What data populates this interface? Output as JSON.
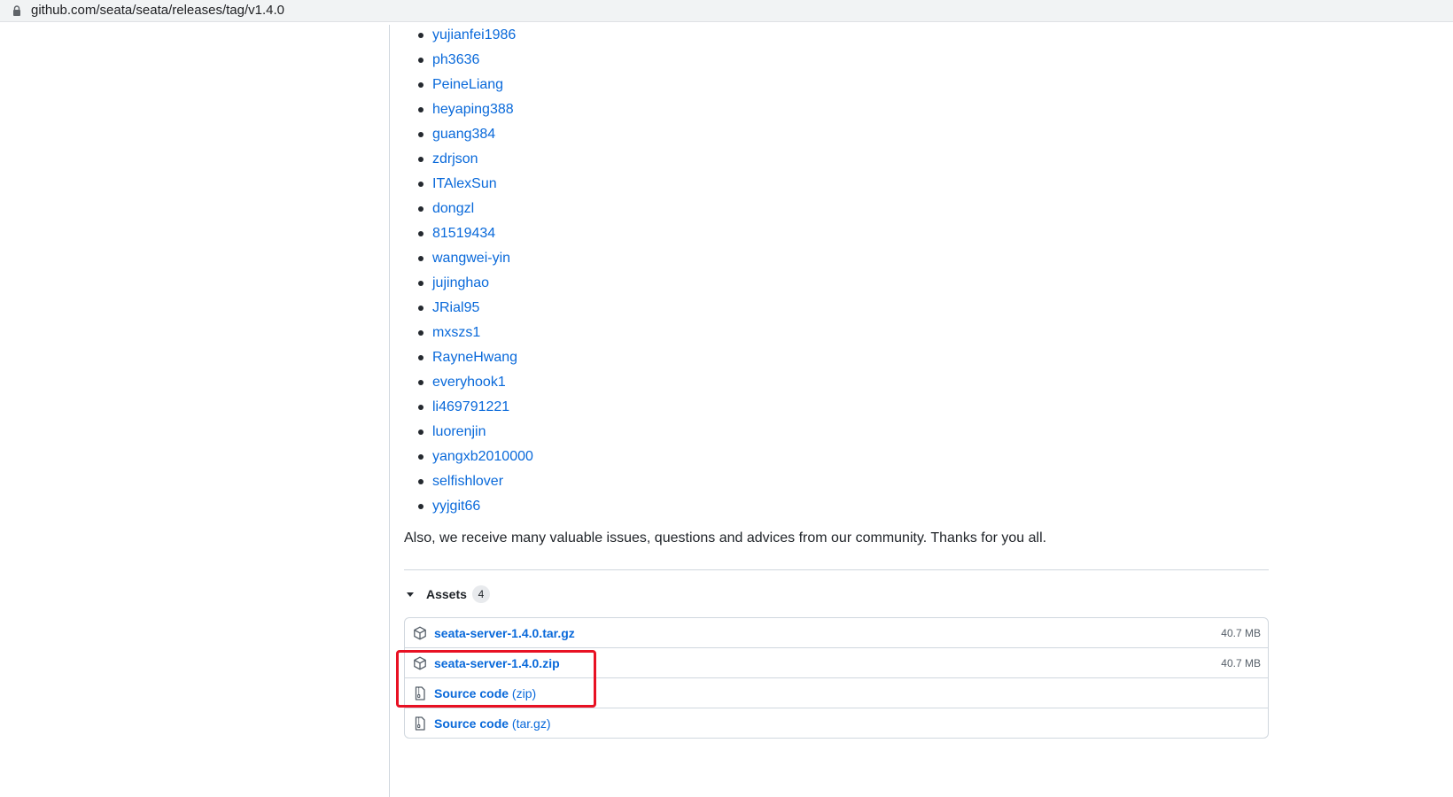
{
  "browser": {
    "url": "github.com/seata/seata/releases/tag/v1.4.0"
  },
  "contributors": [
    "yujianfei1986",
    "ph3636",
    "PeineLiang",
    "heyaping388",
    "guang384",
    "zdrjson",
    "ITAlexSun",
    "dongzl",
    "81519434",
    "wangwei-yin",
    "jujinghao",
    "JRial95",
    "mxszs1",
    "RayneHwang",
    "everyhook1",
    "li469791221",
    "luorenjin",
    "yangxb2010000",
    "selfishlover",
    "yyjgit66"
  ],
  "thanks_text": "Also, we receive many valuable issues, questions and advices from our community. Thanks for you all.",
  "assets": {
    "title": "Assets",
    "count": "4",
    "items": [
      {
        "name": "seata-server-1.4.0.tar.gz",
        "suffix": "",
        "size": "40.7 MB",
        "icon": "package-icon"
      },
      {
        "name": "seata-server-1.4.0.zip",
        "suffix": "",
        "size": "40.7 MB",
        "icon": "package-icon"
      },
      {
        "name": "Source code",
        "suffix": "(zip)",
        "size": "",
        "icon": "file-zip-icon"
      },
      {
        "name": "Source code",
        "suffix": "(tar.gz)",
        "size": "",
        "icon": "file-zip-icon"
      }
    ]
  },
  "colors": {
    "link": "#0969da",
    "highlight": "#e81123",
    "border": "#d0d7de"
  }
}
